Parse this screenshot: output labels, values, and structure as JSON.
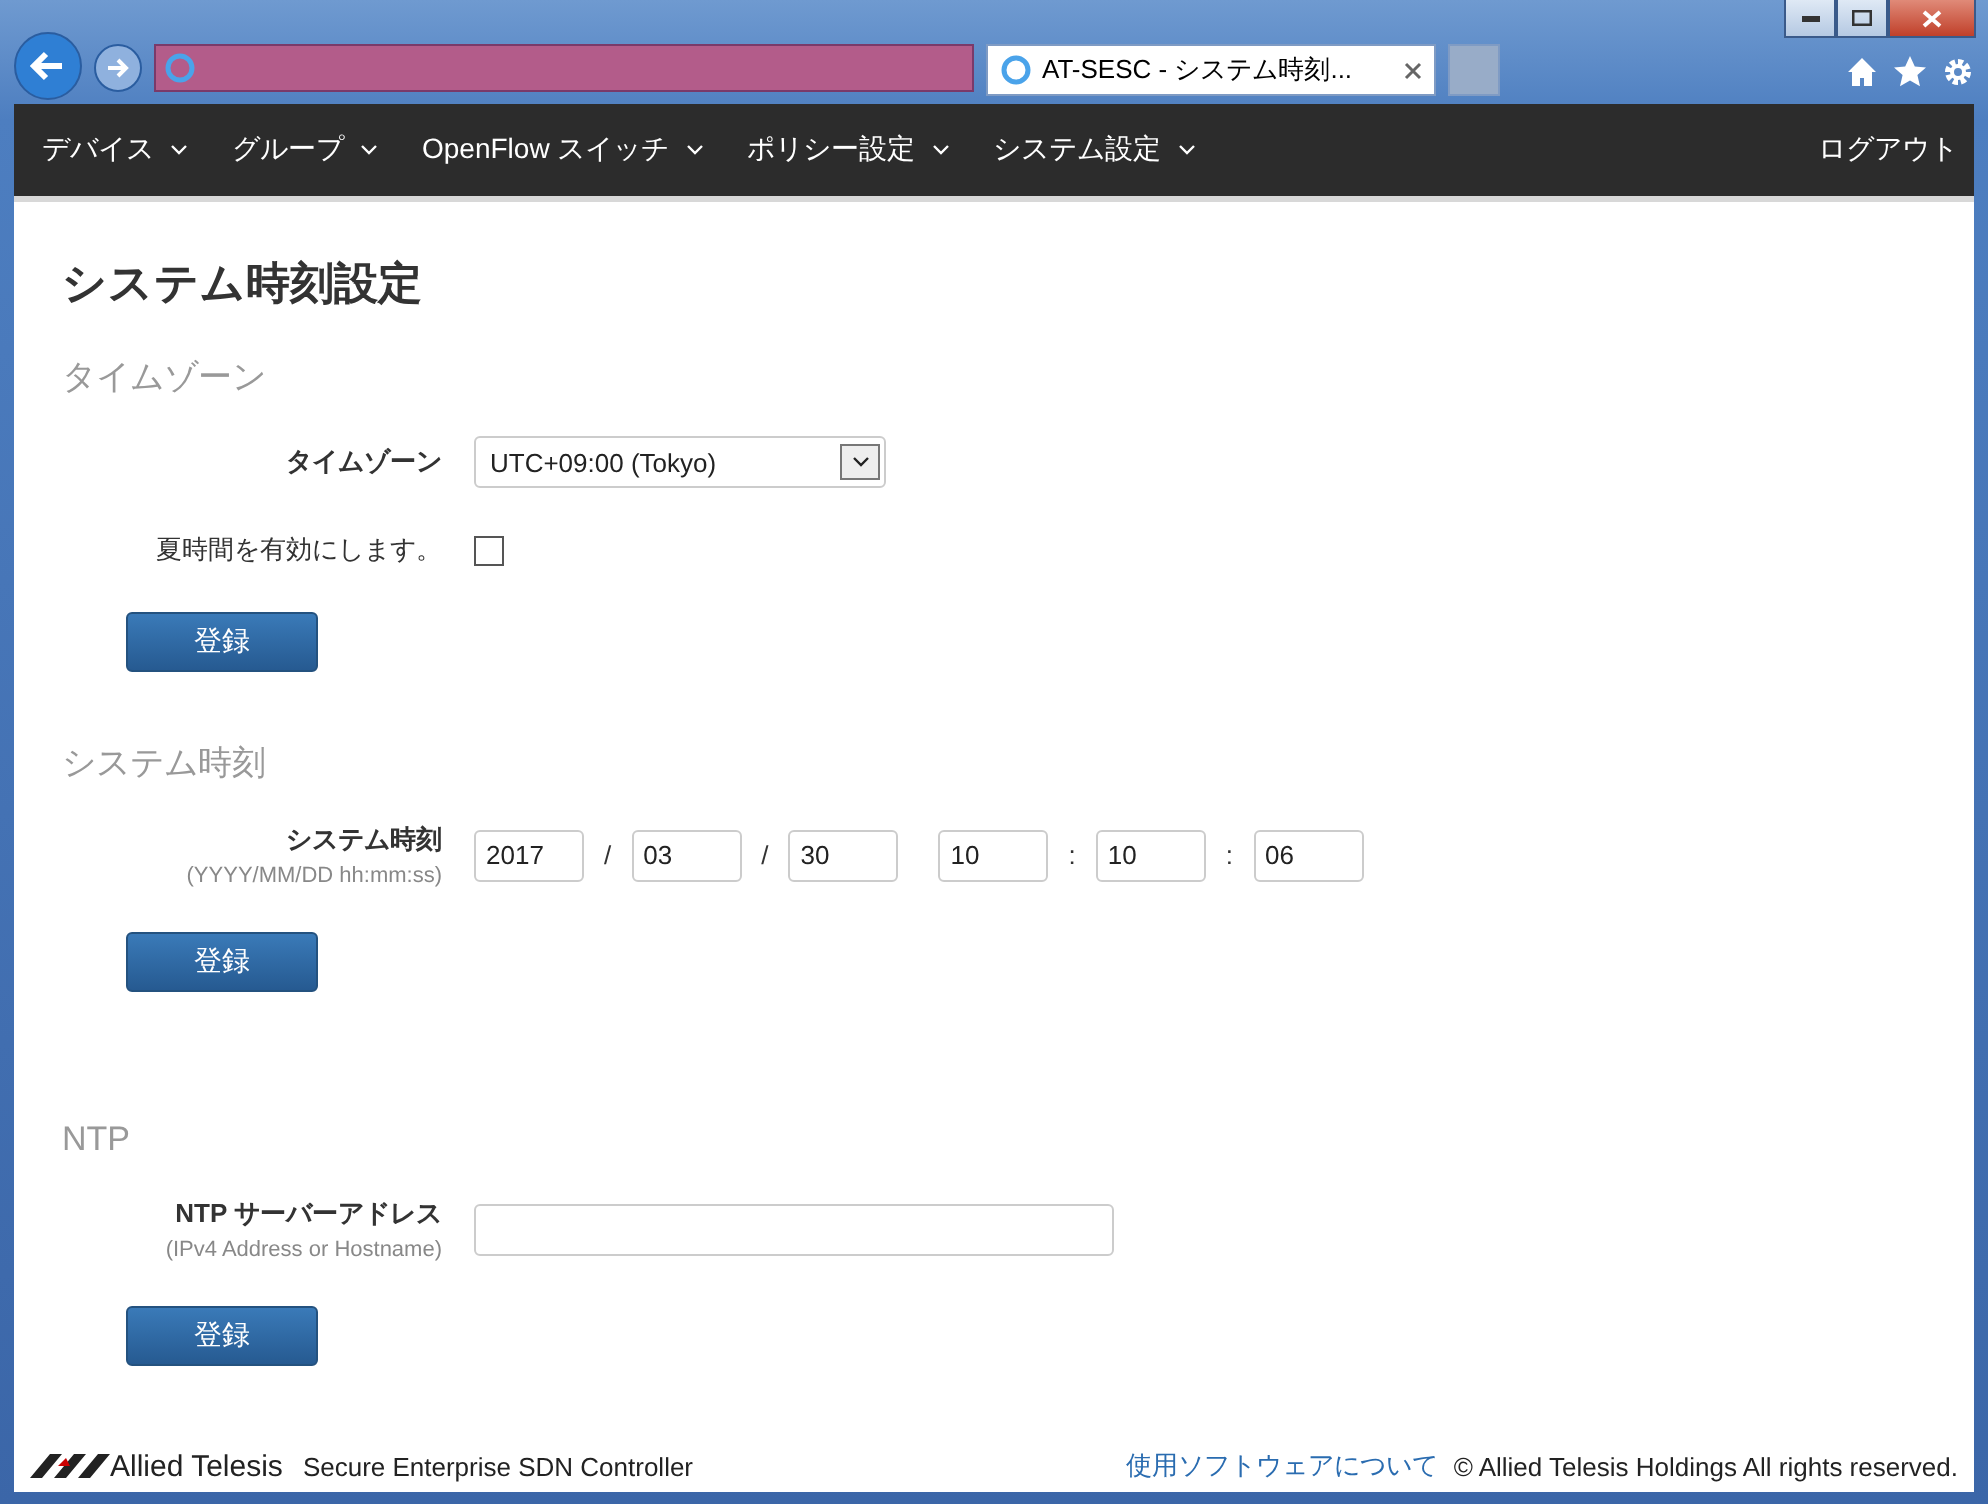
{
  "browser": {
    "tab": {
      "title": "AT-SESC - システム時刻...",
      "selected": true
    }
  },
  "nav": {
    "items": [
      {
        "label": "デバイス",
        "kind": "dropdown"
      },
      {
        "label": "グループ",
        "kind": "dropdown"
      },
      {
        "label": "OpenFlow スイッチ",
        "kind": "dropdown"
      },
      {
        "label": "ポリシー設定",
        "kind": "dropdown"
      },
      {
        "label": "システム設定",
        "kind": "dropdown"
      }
    ],
    "logout": "ログアウト"
  },
  "page": {
    "title": "システム時刻設定"
  },
  "sections": [
    {
      "heading": "タイムゾーン",
      "fields": [
        {
          "kind": "select",
          "label": "タイムゾーン",
          "value": "UTC+09:00 (Tokyo)"
        },
        {
          "kind": "checkbox",
          "label": "夏時間を有効にします。",
          "checked": false
        }
      ],
      "button": "登録"
    },
    {
      "heading": "システム時刻",
      "fields": [
        {
          "kind": "datetime",
          "label": "システム時刻",
          "hint": "(YYYY/MM/DD hh:mm:ss)",
          "parts": [
            {
              "kind": "input",
              "text": "2017"
            },
            {
              "kind": "sep",
              "text": "/"
            },
            {
              "kind": "input",
              "text": "03"
            },
            {
              "kind": "sep",
              "text": "/"
            },
            {
              "kind": "input",
              "text": "30"
            },
            {
              "kind": "gap"
            },
            {
              "kind": "input",
              "text": "10"
            },
            {
              "kind": "sep",
              "text": ":"
            },
            {
              "kind": "input",
              "text": "10"
            },
            {
              "kind": "sep",
              "text": ":"
            },
            {
              "kind": "input",
              "text": "06"
            }
          ]
        }
      ],
      "button": "登録"
    },
    {
      "heading": "NTP",
      "fields": [
        {
          "kind": "text",
          "label": "NTP サーバーアドレス",
          "hint": "(IPv4 Address or Hostname)"
        }
      ],
      "button": "登録"
    }
  ],
  "footer": {
    "logo": "Allied Telesis",
    "product": "Secure Enterprise SDN Controller",
    "link": "使用ソフトウェアについて",
    "copyright": "© Allied Telesis Holdings All rights reserved."
  }
}
